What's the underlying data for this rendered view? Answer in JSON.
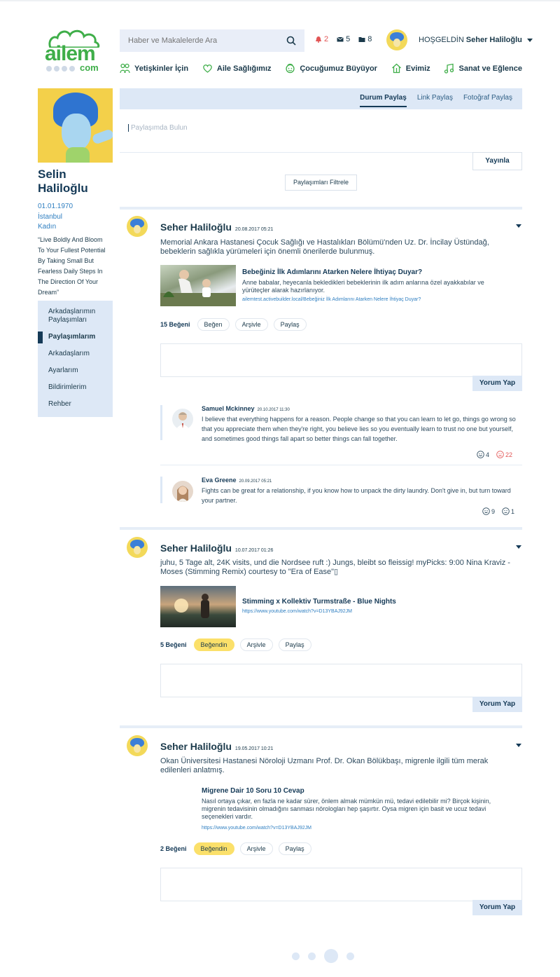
{
  "brand": {
    "logo_word": "ailem",
    "logo_suffix": "com",
    "brand_color": "#3fae49",
    "accent": "#dde8f6",
    "like_color": "#fbe06a"
  },
  "header": {
    "search_placeholder": "Haber ve Makalelerde Ara",
    "notifications": "2",
    "messages": "5",
    "folders": "8",
    "welcome_label": "HOŞGELDİN",
    "user_name": "Seher Haliloğlu"
  },
  "nav": [
    {
      "label": "Yetişkinler İçin",
      "icon": "people-icon"
    },
    {
      "label": "Aile Sağlığımız",
      "icon": "heart-icon"
    },
    {
      "label": "Çocuğumuz Büyüyor",
      "icon": "child-face-icon"
    },
    {
      "label": "Evimiz",
      "icon": "home-icon"
    },
    {
      "label": "Sanat ve Eğlence",
      "icon": "music-note-icon"
    }
  ],
  "profile": {
    "name": "Selin Haliloğlu",
    "birthdate": "01.01.1970",
    "city": "İstanbul",
    "gender": "Kadın",
    "quote": "“Live Boldly And Bloom To Your Fullest Potential By Taking Small But Fearless Daily Steps In The Direction Of Your Dream”"
  },
  "side_menu": [
    {
      "label": "Arkadaşlarımın Paylaşımları"
    },
    {
      "label": "Paylaşımlarım"
    },
    {
      "label": "Arkadaşlarım"
    },
    {
      "label": "Ayarlarım"
    },
    {
      "label": "Bildirimlerim"
    },
    {
      "label": "Rehber"
    }
  ],
  "share": {
    "tabs": [
      "Durum Paylaş",
      "Link Paylaş",
      "Fotoğraf Paylaş"
    ],
    "placeholder": "Paylaşımda Bulun",
    "publish": "Yayınla",
    "filter": "Paylaşımları Filtrele"
  },
  "posts": [
    {
      "author": "Seher Haliloğlu",
      "date": "20.08.2017 05:21",
      "text": "Memorial Ankara Hastanesi Çocuk Sağlığı ve Hastalıkları Bölümü'nden Uz. Dr. İncilay Üstündağ, bebeklerin sağlıkla yürümeleri için önemli önerilerde bulunmuş.",
      "link_title": "Bebeğiniz İlk Adımlarını Atarken Nelere İhtiyaç Duyar?",
      "link_desc": "Anne babalar, heyecanla bekledikleri bebeklerinin ilk adım anlarına özel ayakkabılar ve yürüteçler alarak hazırlanıyor.",
      "link_url": "ailemtest.activebuilder.local/Bebeğiniz İlk Adımlarını Atarken Nelere İhtiyaç Duyar?",
      "likes": "15 Beğeni",
      "like_label": "Beğen",
      "archive": "Arşivle",
      "share": "Paylaş",
      "comment_btn": "Yorum Yap",
      "comments": [
        {
          "name": "Samuel Mckinney",
          "date": "20.10.2017 11:30",
          "text": "I believe that everything happens for a reason. People change so that you can learn to let go, things go wrong so that you appreciate them when they're right, you believe lies so you eventually learn to trust no one but yourself, and sometimes good things fall apart so better things can fall together.",
          "happy": "4",
          "sad": "22"
        },
        {
          "name": "Eva Greene",
          "date": "20.09.2017 05:21",
          "text": "Fights can be great for a relationship, if you know how to unpack the dirty laundry. Don't give in, but turn toward your partner.",
          "happy": "9",
          "neutral": "1"
        }
      ]
    },
    {
      "author": "Seher Haliloğlu",
      "date": "10.07.2017 01:26",
      "text": "juhu, 5 Tage alt, 24K visits, und die Nordsee ruft :) Jungs, bleibt so fleissig! myPicks: 9:00 Nina Kraviz - Moses (Stimming Remix) courtesy to \"Era of Ease\"▯",
      "link_title": "Stimming x Kollektiv Turmstraße - Blue Nights",
      "link_url": "https://www.youtube.com/watch?v=D13YBAJ92JM",
      "likes": "5 Beğeni",
      "like_label": "Beğendin",
      "archive": "Arşivle",
      "share": "Paylaş",
      "comment_btn": "Yorum Yap"
    },
    {
      "author": "Seher Haliloğlu",
      "date": "19.05.2017 10:21",
      "text": "Okan Üniversitesi Hastanesi Nöroloji Uzmanı Prof. Dr. Okan Bölükbaşı, migrenle ilgili tüm merak edilenleri anlatmış.",
      "link_title": "Migrene Dair 10 Soru 10 Cevap",
      "link_desc": "Nasıl ortaya çıkar, en fazla ne kadar sürer, önlem almak mümkün mü, tedavi edilebilir mi? Birçok kişinin, migrenin tedavisinin olmadığını sanması nörologları hep şaşırtır. Oysa migren için basit ve ucuz tedavi seçenekleri vardır.",
      "link_url": "https://www.youtube.com/watch?v=D13YBAJ92JM",
      "likes": "2 Beğeni",
      "like_label": "Beğendin",
      "archive": "Arşivle",
      "share": "Paylaş",
      "comment_btn": "Yorum Yap"
    }
  ],
  "pager": {
    "pages": 4,
    "current": 3
  }
}
